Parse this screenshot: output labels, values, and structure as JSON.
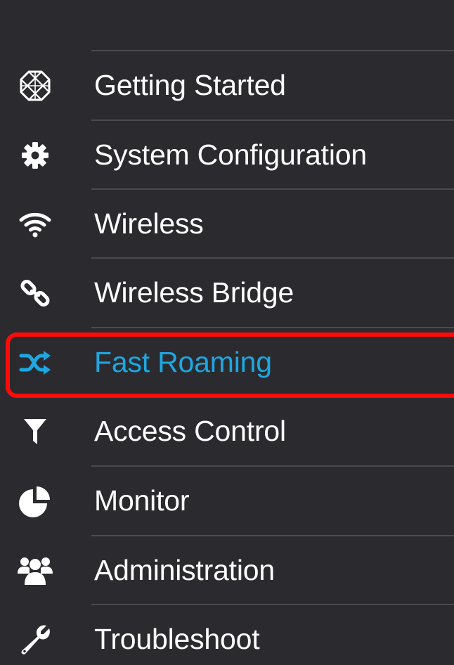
{
  "nav": {
    "items": [
      {
        "label": "Getting Started",
        "icon": "getting-started-icon",
        "active": false
      },
      {
        "label": "System Configuration",
        "icon": "gear-icon",
        "active": false
      },
      {
        "label": "Wireless",
        "icon": "wifi-icon",
        "active": false
      },
      {
        "label": "Wireless Bridge",
        "icon": "link-icon",
        "active": false
      },
      {
        "label": "Fast Roaming",
        "icon": "shuffle-icon",
        "active": true
      },
      {
        "label": "Access Control",
        "icon": "filter-icon",
        "active": false
      },
      {
        "label": "Monitor",
        "icon": "pie-chart-icon",
        "active": false
      },
      {
        "label": "Administration",
        "icon": "users-icon",
        "active": false
      },
      {
        "label": "Troubleshoot",
        "icon": "wrench-icon",
        "active": false
      }
    ]
  },
  "colors": {
    "background": "#2b2b2f",
    "text": "#ffffff",
    "active_text": "#1ea7e1",
    "separator": "#4a4a4f",
    "highlight": "#ff0a0a"
  }
}
